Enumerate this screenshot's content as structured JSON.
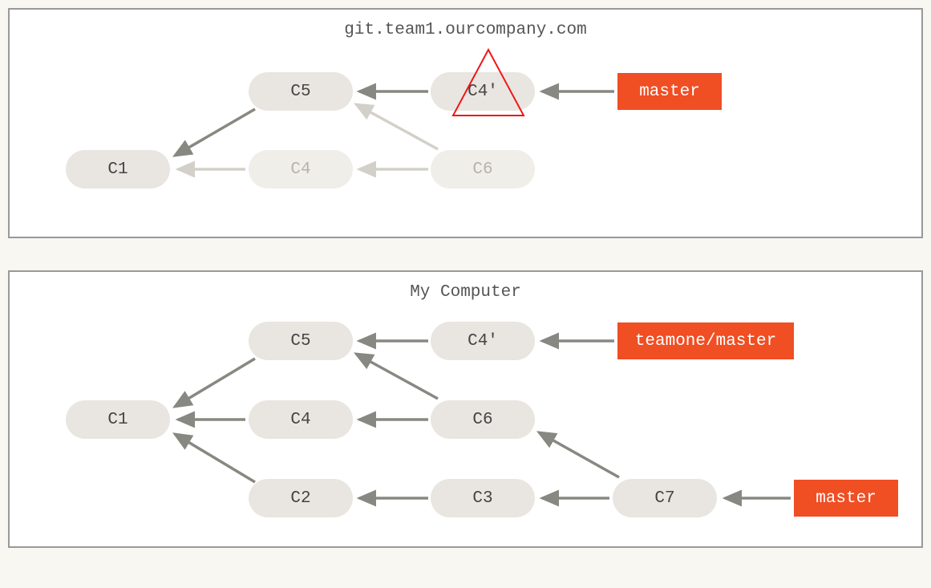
{
  "panels": {
    "server": {
      "title": "git.team1.ourcompany.com",
      "commits": {
        "c1": "C1",
        "c5": "C5",
        "c4p": "C4'",
        "c4": "C4",
        "c6": "C6"
      },
      "refs": {
        "master": "master"
      }
    },
    "local": {
      "title": "My Computer",
      "commits": {
        "c1": "C1",
        "c5": "C5",
        "c4p": "C4'",
        "c4": "C4",
        "c6": "C6",
        "c2": "C2",
        "c3": "C3",
        "c7": "C7"
      },
      "refs": {
        "teamone_master": "teamone/master",
        "master": "master"
      }
    }
  },
  "colors": {
    "node_bg": "#e9e6e1",
    "node_faded_bg": "#f0eee9",
    "ref_bg": "#f04e23",
    "arrow": "#888882",
    "arrow_faded": "#d3d0c9",
    "highlight_red": "#f01616",
    "border": "#999999"
  }
}
